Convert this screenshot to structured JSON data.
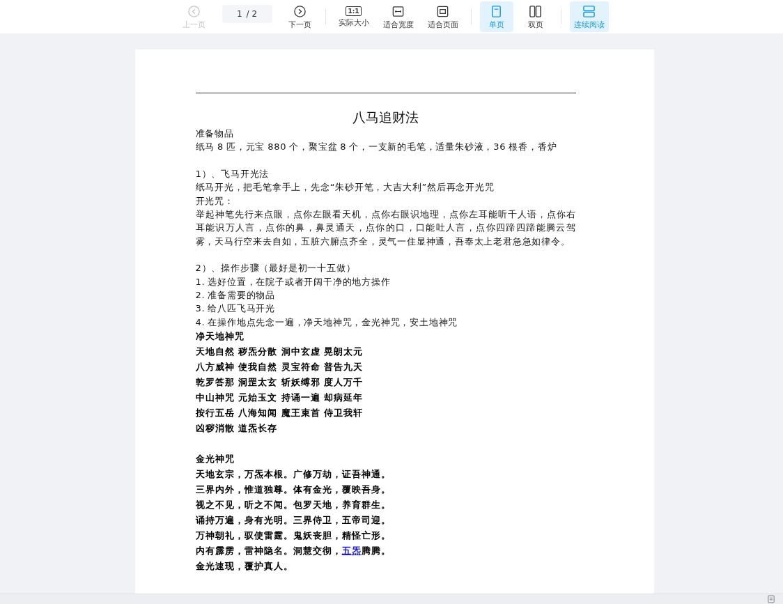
{
  "toolbar": {
    "groups": [
      [
        {
          "kind": "prev",
          "label": "上一页",
          "disabled": true
        },
        {
          "kind": "pager",
          "current": "1",
          "total": "/ 2"
        },
        {
          "kind": "next",
          "label": "下一页",
          "disabled": false
        }
      ],
      [
        {
          "kind": "actual",
          "label": "实际大小",
          "icon_text": "1:1"
        },
        {
          "kind": "fitwidth",
          "label": "适合宽度"
        },
        {
          "kind": "fitpage",
          "label": "适合页面"
        }
      ],
      [
        {
          "kind": "single",
          "label": "单页",
          "selected": true
        },
        {
          "kind": "double",
          "label": "双页",
          "selected": false
        }
      ],
      [
        {
          "kind": "continuous",
          "label": "连续阅读",
          "selected": true
        }
      ]
    ]
  },
  "document": {
    "title": "八马追财法",
    "blocks": [
      {
        "kind": "text",
        "text": "准备物品"
      },
      {
        "kind": "text",
        "text": "纸马 8 匹，元宝 880 个，聚宝盆 8 个，一支新的毛笔，适量朱砂液，36 根香，香炉"
      },
      {
        "kind": "blank"
      },
      {
        "kind": "text",
        "text": "1）、飞马开光法"
      },
      {
        "kind": "text",
        "text": "纸马开光，把毛笔拿手上，先念“朱砂开笔，大吉大利”然后再念开光咒"
      },
      {
        "kind": "text",
        "text": "开光咒："
      },
      {
        "kind": "text",
        "text": "举起神笔先行来点眼，点你左眼看天机，点你右眼识地理，点你左耳能听千人语，点你右耳能识万人言，点你的鼻，鼻灵通天，点你的口，口能吐人言，点你四蹄四蹄能腾云驾雾，天马行空来去自如，五脏六腑点齐全，灵气一住显神通，吾奉太上老君急急如律令。"
      },
      {
        "kind": "blank"
      },
      {
        "kind": "text",
        "text": "2）、操作步骤（最好是初一十五做）"
      },
      {
        "kind": "text",
        "text": "1.  选好位置，在院子或者开阔干净的地方操作"
      },
      {
        "kind": "text",
        "text": "2.  准备需要的物品"
      },
      {
        "kind": "text",
        "text": "3.  给八匹飞马开光"
      },
      {
        "kind": "text",
        "text": "4.  在操作地点先念一遍，净天地神咒，金光神咒，安土地神咒"
      },
      {
        "kind": "verse",
        "text": "净天地神咒"
      },
      {
        "kind": "verse",
        "text": "天地自然 秽炁分散 洞中玄虚 晃朗太元"
      },
      {
        "kind": "verse",
        "text": "八方威神 使我自然 灵宝符命 普告九天"
      },
      {
        "kind": "verse",
        "text": "乾罗答那 洞罡太玄 斩妖缚邪 度人万千"
      },
      {
        "kind": "verse",
        "text": "中山神咒 元始玉文 持诵一遍 却病延年"
      },
      {
        "kind": "verse",
        "text": "按行五岳 八海知闻 魔王束首 侍卫我轩"
      },
      {
        "kind": "verse",
        "text": "凶秽消散 道炁长存"
      },
      {
        "kind": "verse_blank"
      },
      {
        "kind": "verse",
        "text": "金光神咒"
      },
      {
        "kind": "verse",
        "text": "天地玄宗，万炁本根。广修万劫，证吾神通。"
      },
      {
        "kind": "verse",
        "text": "三界内外，惟道独尊。体有金光，覆映吾身。"
      },
      {
        "kind": "verse",
        "text": "视之不见，听之不闻。包罗天地，养育群生。"
      },
      {
        "kind": "verse",
        "text": "诵持万遍，身有光明。三界侍卫，五帝司迎。"
      },
      {
        "kind": "verse",
        "text": "万神朝礼，驭使雷霆。鬼妖丧胆，精怪亡形。"
      },
      {
        "kind": "verse_link",
        "before": "内有霹雳，雷神隐名。洞慧交彻，",
        "link": "五炁",
        "after": "腾腾。"
      },
      {
        "kind": "verse",
        "text": "金光速现，覆护真人。"
      }
    ]
  }
}
